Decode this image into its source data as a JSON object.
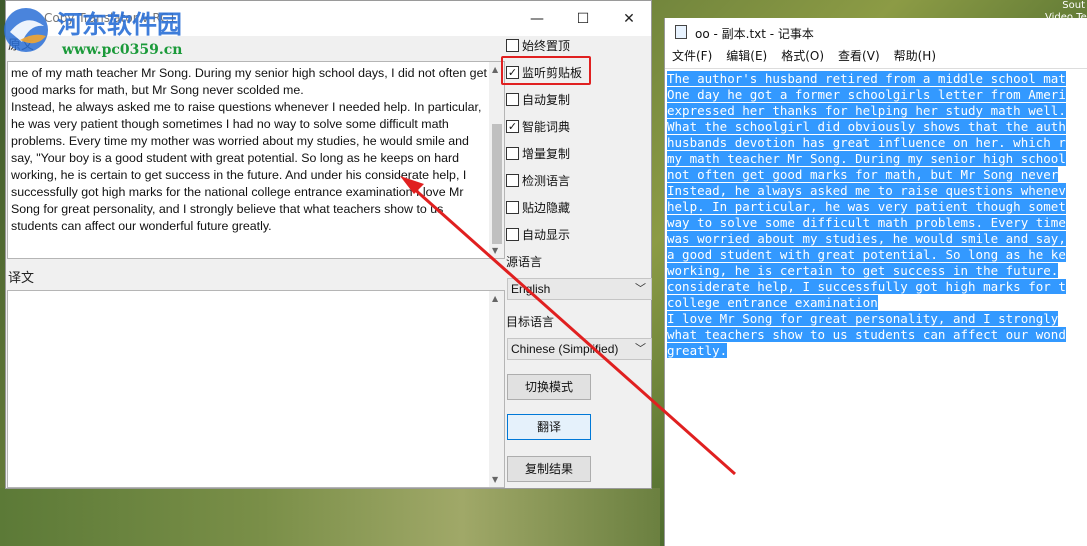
{
  "desktop": {
    "corner_text": "Sout\nVideo Te"
  },
  "watermark": {
    "title": "河东软件园",
    "url": "www.pc0359.cn"
  },
  "translator": {
    "title_partial": "Copy Translator v RC1",
    "source_label": "原文",
    "source_text": "me of my math teacher Mr Song. During my senior high school days, I did not often get good marks for math, but Mr Song never scolded me.\nInstead, he always asked me to raise questions whenever I needed help. In particular, he was very patient though sometimes I had no way to solve some difficult math problems. Every time my mother was worried about my studies, he would smile and say, \"Your boy is a good student with great potential. So long as he keeps on hard working, he is certain to get success in the future. And under his considerate help, I successfully got high marks for the national college entrance examination I love Mr Song for great personality, and I strongly believe that what teachers show to us students can affect our wonderful future greatly.",
    "target_label": "译文",
    "options": [
      {
        "label": "始终置顶",
        "checked": false
      },
      {
        "label": "监听剪贴板",
        "checked": true
      },
      {
        "label": "自动复制",
        "checked": false
      },
      {
        "label": "智能词典",
        "checked": true
      },
      {
        "label": "增量复制",
        "checked": false
      },
      {
        "label": "检测语言",
        "checked": false
      },
      {
        "label": "贴边隐藏",
        "checked": false
      },
      {
        "label": "自动显示",
        "checked": false
      }
    ],
    "source_lang_label": "源语言",
    "source_lang_value": "English",
    "target_lang_label": "目标语言",
    "target_lang_value": "Chinese (Simplified)",
    "buttons": {
      "switch_mode": "切换模式",
      "translate": "翻译",
      "copy_result": "复制结果"
    },
    "check_mark": "✓",
    "window_controls": {
      "minimize": "—",
      "maximize": "☐",
      "close": "✕"
    }
  },
  "notepad": {
    "title": "oo - 副本.txt - 记事本",
    "menu": [
      "文件(F)",
      "编辑(E)",
      "格式(O)",
      "查看(V)",
      "帮助(H)"
    ],
    "lines": [
      "The author's husband retired from a middle school mat",
      "One day he got a former schoolgirls letter from Ameri",
      "expressed her thanks for helping her study math well.",
      "What the schoolgirl did obviously shows that the auth",
      "husbands devotion has great influence on her. which r",
      "my math teacher Mr Song. During my senior high school",
      "not often get good marks for math, but Mr Song never",
      "Instead, he always asked me to raise questions whenev",
      "help. In particular, he was very patient though somet",
      "way to solve some difficult math problems. Every time",
      "was worried about my studies, he would smile and say,",
      "a good student with great potential. So long as he ke",
      "working, he is certain to get success in the future.",
      "considerate help, I successfully got high marks for t",
      "college entrance examination",
      "I love Mr Song for great personality, and I strongly",
      "what teachers show to us students can affect our wond",
      "greatly."
    ]
  },
  "colors": {
    "highlight_red": "#e02020",
    "selection_blue": "#3399ff",
    "watermark_blue": "#2a6fd6",
    "watermark_green": "#1b9a3a"
  }
}
